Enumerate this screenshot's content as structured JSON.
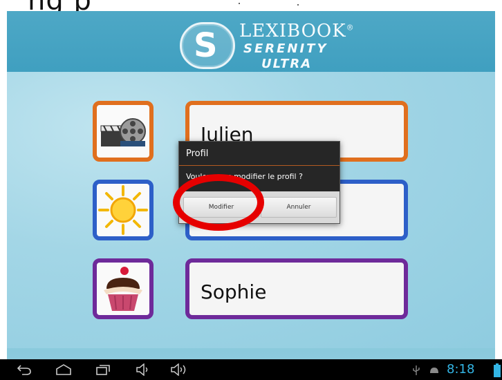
{
  "top_strip": {
    "cut_text": "ng p"
  },
  "header": {
    "brand_line1": "LEXIBOOK",
    "brand_mark": "®",
    "brand_line2": "SERENITY",
    "brand_line3": "ULTRA"
  },
  "profiles": [
    {
      "name": "Julien",
      "icon": "film-camera-icon",
      "color": "#e06f1e"
    },
    {
      "name": "",
      "icon": "sun-icon",
      "color": "#2d5fc8"
    },
    {
      "name": "Sophie",
      "icon": "cupcake-icon",
      "color": "#6e2a9a"
    }
  ],
  "dialog": {
    "title": "Profil",
    "message": "Voulez-vous modifier le profil ?",
    "confirm_label": "Modifier",
    "cancel_label": "Annuler"
  },
  "navbar": {
    "back_icon": "back-icon",
    "home_icon": "home-icon",
    "recent_icon": "recent-apps-icon",
    "vol_down_icon": "volume-down-icon",
    "vol_up_icon": "volume-up-icon",
    "usb_icon": "usb-icon",
    "android_icon": "android-debug-icon",
    "time": "8:18",
    "battery_icon": "battery-icon",
    "clock_color": "#33b5e5"
  }
}
